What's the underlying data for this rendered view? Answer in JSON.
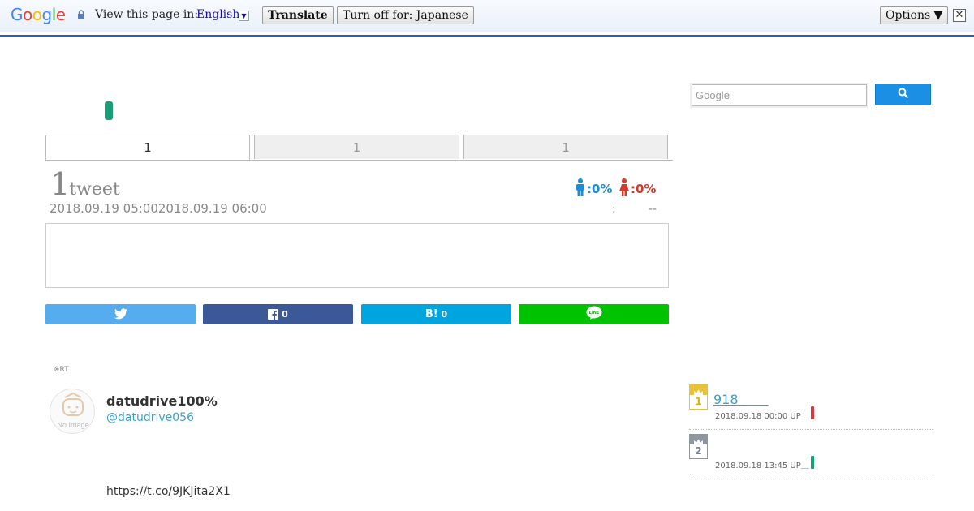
{
  "translate_bar": {
    "logo": "Google",
    "view_label": "View this page in:",
    "language": "English",
    "translate_button": "Translate",
    "turnoff_button": "Turn off for: Japanese",
    "options_button": "Options ▼",
    "close_glyph": "✕"
  },
  "search": {
    "placeholder": "Google"
  },
  "tabs": [
    {
      "label": "1",
      "active": true
    },
    {
      "label": "1",
      "active": false
    },
    {
      "label": "1",
      "active": false
    }
  ],
  "summary": {
    "tweet_count": "1",
    "tweet_word": "tweet",
    "date_range": "2018.09.19 05:002018.09.19 06:00",
    "male_pct": ":0%",
    "female_pct": ":0%",
    "meta_colon": ":",
    "meta_dash": "--"
  },
  "share": {
    "facebook_count": "0",
    "hatena_label": "B!",
    "hatena_count": "0",
    "line_label": "LINE"
  },
  "tweet": {
    "rt_note": "※RT",
    "avatar_caption": "No Image",
    "user_name": "datudrive100%",
    "user_handle": "@datudrive056",
    "link": "https://t.co/9JKJita2X1"
  },
  "ranking": [
    {
      "rank": "1",
      "title": "918 ＿＿",
      "date": "2018.09.18 00:00 UP＿",
      "bar_color": "#d23b3b"
    },
    {
      "rank": "2",
      "title": "",
      "date": "2018.09.18 13:45 UP＿",
      "bar_color": "#1a9e79"
    }
  ],
  "colors": {
    "accent_blue": "#3aa3c9",
    "male": "#1c8fd4",
    "female": "#d23b2b",
    "twitter": "#55acee",
    "facebook": "#3b5998",
    "hatena": "#00a4de",
    "line": "#00c300"
  }
}
